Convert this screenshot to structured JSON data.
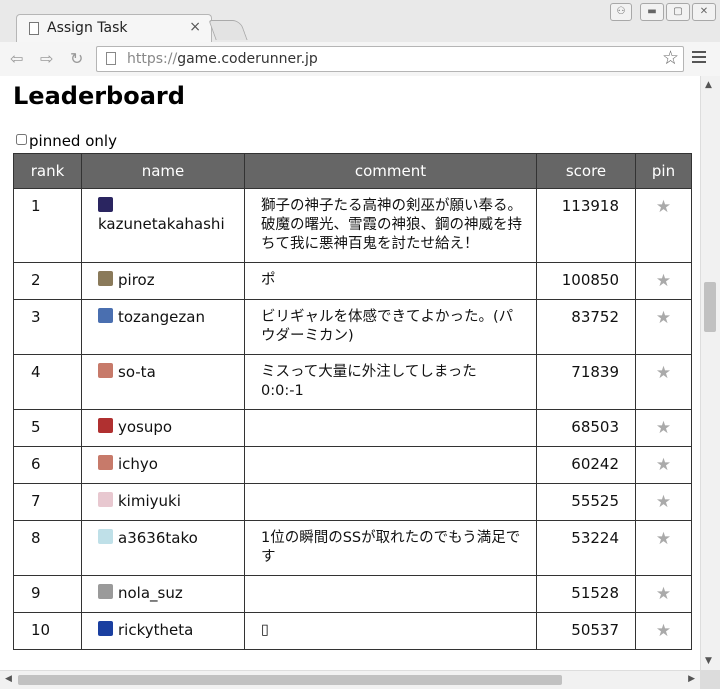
{
  "tab": {
    "title": "Assign Task",
    "close": "×"
  },
  "window_controls": {
    "user": "👤",
    "minimize": "–",
    "maximize": "□",
    "close": "✕"
  },
  "nav": {
    "back": "⇦",
    "forward": "⇨",
    "reload": "↻"
  },
  "address": {
    "scheme": "https://",
    "host": "game.coderunner.jp"
  },
  "page": {
    "title": "Leaderboard",
    "filter_label": "pinned only",
    "columns": [
      "rank",
      "name",
      "comment",
      "score",
      "pin"
    ]
  },
  "rows": [
    {
      "rank": "1",
      "name": "kazunetakahashi",
      "comment": "獅子の神子たる高神の剣巫が願い奉る。破魔の曙光、雪霞の神狼、鋼の神威を持ちて我に悪神百鬼を討たせ給え！",
      "score": "113918",
      "avatar_color": "#2a2560"
    },
    {
      "rank": "2",
      "name": "piroz",
      "comment": "ポ",
      "score": "100850",
      "avatar_color": "#8a7a5a"
    },
    {
      "rank": "3",
      "name": "tozangezan",
      "comment": "ビリギャルを体感できてよかった。(パウダーミカン)",
      "score": "83752",
      "avatar_color": "#4a6fb0"
    },
    {
      "rank": "4",
      "name": "so-ta",
      "comment": "ミスって大量に外注してしまった 0:0:-1",
      "score": "71839",
      "avatar_color": "#c77a6a"
    },
    {
      "rank": "5",
      "name": "yosupo",
      "comment": "",
      "score": "68503",
      "avatar_color": "#b03030"
    },
    {
      "rank": "6",
      "name": "ichyo",
      "comment": "",
      "score": "60242",
      "avatar_color": "#c77a6a"
    },
    {
      "rank": "7",
      "name": "kimiyuki",
      "comment": "",
      "score": "55525",
      "avatar_color": "#e8c8d0"
    },
    {
      "rank": "8",
      "name": "a3636tako",
      "comment": "1位の瞬間のSSが取れたのでもう満足です",
      "score": "53224",
      "avatar_color": "#bfe0e8"
    },
    {
      "rank": "9",
      "name": "nola_suz",
      "comment": "",
      "score": "51528",
      "avatar_color": "#9a9a9a"
    },
    {
      "rank": "10",
      "name": "rickytheta",
      "comment": "▯",
      "score": "50537",
      "avatar_color": "#1a3fa0"
    }
  ],
  "pin_glyph": "★"
}
